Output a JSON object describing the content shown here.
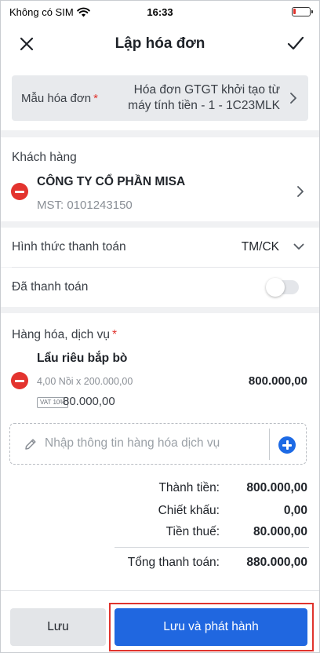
{
  "status_bar": {
    "carrier": "Không có SIM",
    "time": "16:33",
    "icons": [
      "wifi-icon",
      "battery-low-icon"
    ]
  },
  "nav": {
    "title": "Lập hóa đơn",
    "close_icon": "close-icon",
    "confirm_icon": "check-icon"
  },
  "invoice_template": {
    "label": "Mẫu hóa đơn",
    "required_mark": "*",
    "value_line1": "Hóa đơn GTGT khởi tạo từ",
    "value_line2": "máy tính tiền - 1 - 1C23MLK"
  },
  "customer": {
    "section_label": "Khách hàng",
    "name": "CÔNG TY CỔ PHẦN MISA",
    "tax_code": "MST: 0101243150"
  },
  "payment": {
    "method_label": "Hình thức thanh toán",
    "method_value": "TM/CK",
    "paid_label": "Đã thanh toán",
    "paid": false
  },
  "goods": {
    "section_label": "Hàng hóa, dịch vụ",
    "required_mark": "*",
    "items": [
      {
        "name": "Lẩu riêu bắp bò",
        "detail": "4,00 Nồi x 200.000,00",
        "amount": "800.000,00",
        "vat_badge": "VAT 10%",
        "vat_amount": "80.000,00"
      }
    ],
    "add_placeholder": "Nhập thông tin hàng hóa dịch vụ"
  },
  "summary": {
    "subtotal_label": "Thành tiền:",
    "subtotal_value": "800.000,00",
    "discount_label": "Chiết khấu:",
    "discount_value": "0,00",
    "tax_label": "Tiền thuế:",
    "tax_value": "80.000,00",
    "total_label": "Tổng thanh toán:",
    "total_value": "880.000,00"
  },
  "actions": {
    "save_label": "Lưu",
    "save_publish_label": "Lưu và phát hành"
  },
  "colors": {
    "primary": "#2067e0",
    "danger": "#e3342f",
    "background": "#f0f1f3",
    "highlight": "#e0332d"
  }
}
